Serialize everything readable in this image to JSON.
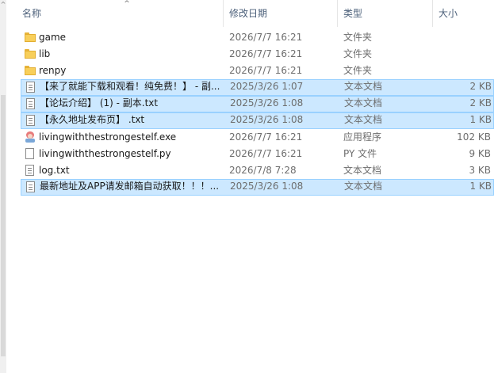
{
  "columns": {
    "name": "名称",
    "date": "修改日期",
    "type": "类型",
    "size": "大小"
  },
  "sort_indicator": "^",
  "files": [
    {
      "name": "game",
      "date": "2026/7/7 16:21",
      "type": "文件夹",
      "size": "",
      "icon": "folder-icon",
      "selected": false
    },
    {
      "name": "lib",
      "date": "2026/7/7 16:21",
      "type": "文件夹",
      "size": "",
      "icon": "folder-icon",
      "selected": false
    },
    {
      "name": "renpy",
      "date": "2026/7/7 16:21",
      "type": "文件夹",
      "size": "",
      "icon": "folder-icon",
      "selected": false
    },
    {
      "name": "【来了就能下载和观看！纯免费！】 - 副...",
      "date": "2025/3/26 1:07",
      "type": "文本文档",
      "size": "2 KB",
      "icon": "text-file-icon",
      "selected": true
    },
    {
      "name": "【论坛介绍】 (1) - 副本.txt",
      "date": "2025/3/26 1:08",
      "type": "文本文档",
      "size": "2 KB",
      "icon": "text-file-icon",
      "selected": true
    },
    {
      "name": "【永久地址发布页】 .txt",
      "date": "2025/3/26 1:08",
      "type": "文本文档",
      "size": "1 KB",
      "icon": "text-file-icon",
      "selected": true
    },
    {
      "name": "livingwiththestrongestelf.exe",
      "date": "2026/7/7 16:21",
      "type": "应用程序",
      "size": "102 KB",
      "icon": "application-icon",
      "selected": false
    },
    {
      "name": "livingwiththestrongestelf.py",
      "date": "2026/7/7 16:21",
      "type": "PY 文件",
      "size": "9 KB",
      "icon": "py-file-icon",
      "selected": false
    },
    {
      "name": "log.txt",
      "date": "2026/7/8 7:28",
      "type": "文本文档",
      "size": "3 KB",
      "icon": "text-file-icon",
      "selected": false
    },
    {
      "name": "最新地址及APP请发邮箱自动获取！！！...",
      "date": "2025/3/26 1:08",
      "type": "文本文档",
      "size": "1 KB",
      "icon": "text-file-icon",
      "selected": true
    }
  ]
}
